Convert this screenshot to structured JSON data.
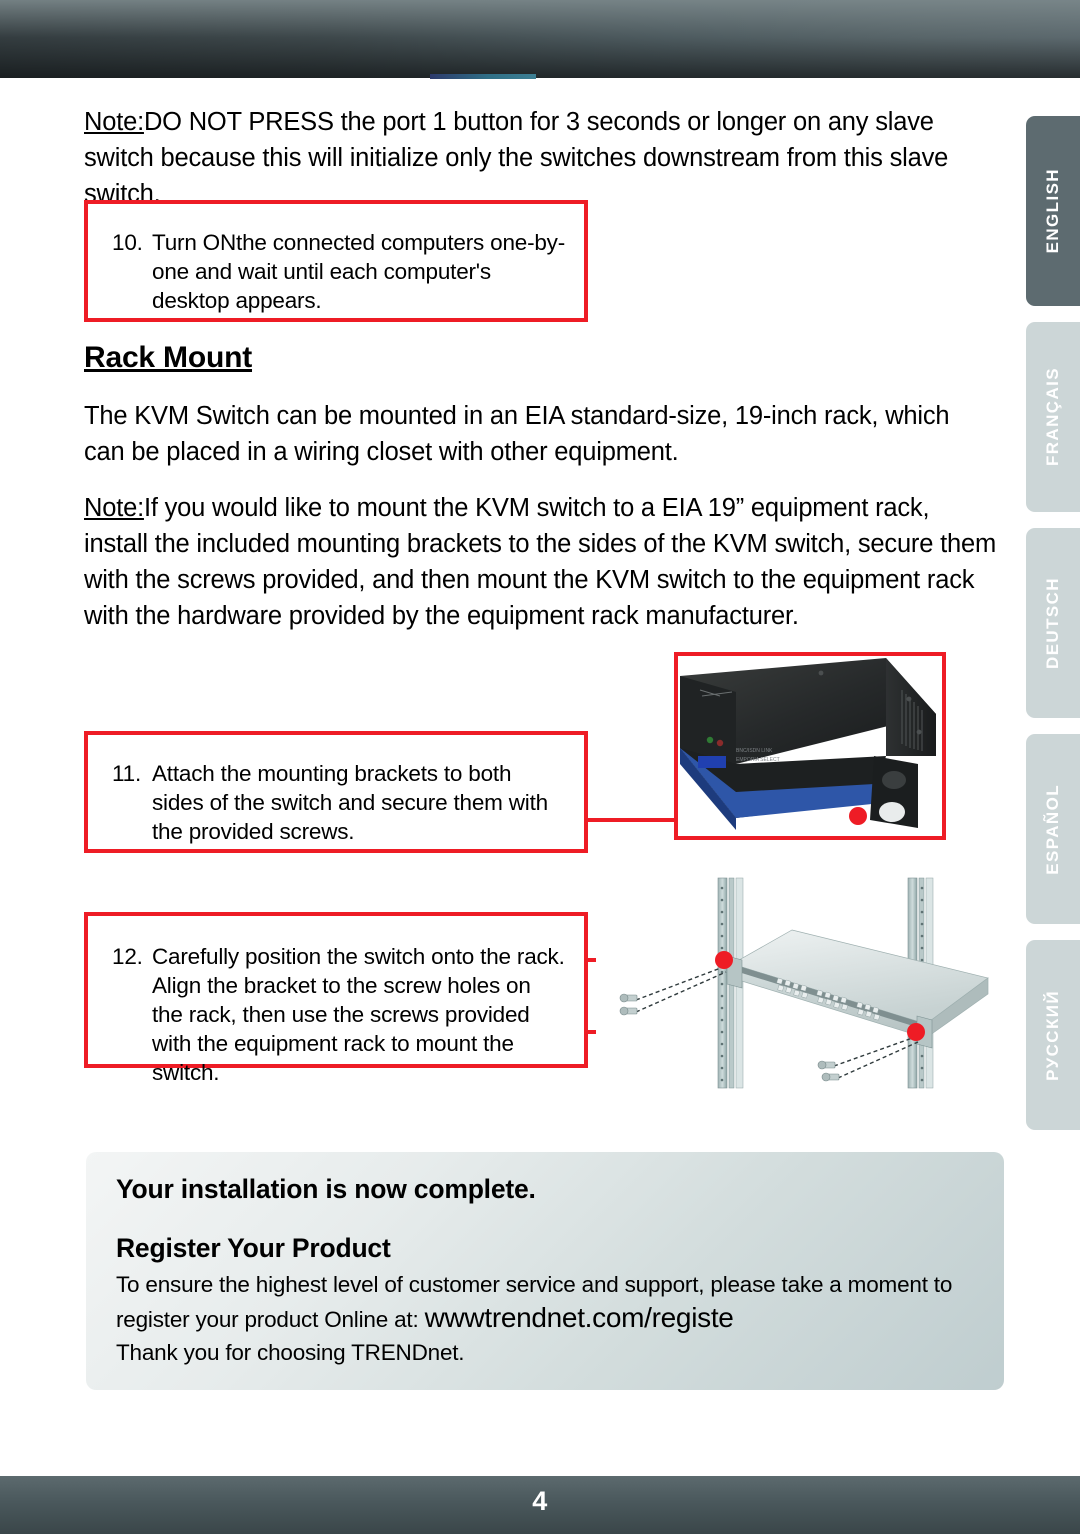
{
  "page": {
    "number": "4",
    "header_accent_color": "#2f6f86",
    "callout_border_color": "#ee1c25"
  },
  "notes": {
    "top": {
      "label": "Note:",
      "text": "DO NOT PRESS the port 1 button for 3 seconds or longer on any slave switch because this will initialize only the switches downstream from this slave switch."
    },
    "rack": {
      "label": "Note:",
      "text": "If you would like to mount the KVM switch to a EIA 19” equipment rack, install the included mounting brackets to the sides of the KVM switch, secure them with the screws provided, and then mount the KVM switch to the equipment rack with the hardware provided by the equipment rack manufacturer."
    }
  },
  "section": {
    "title": "Rack Mount",
    "intro": "The KVM Switch can be mounted in an EIA standard-size, 19-inch rack, which can be placed in a wiring closet with other equipment."
  },
  "steps": [
    {
      "number": "10.",
      "text": "Turn ONthe connected computers one-by-one and wait until each computer's desktop appears."
    },
    {
      "number": "11.",
      "text": "Attach the mounting brackets to both sides of the switch and secure them with the provided screws."
    },
    {
      "number": "12.",
      "text": "Carefully position the switch onto the rack. Align the bracket to the screw holes on the rack, then use the screws provided with the equipment rack to mount the switch."
    }
  ],
  "registration": {
    "complete_title": "Your installation is now complete.",
    "register_title": "Register Your Product",
    "body_line1": "To ensure the highest level of customer service and support, please take a moment to",
    "body_line2_prefix": "register your product Online at:",
    "url": "wwwtrendnet.com/registe",
    "thanks": "Thank you for choosing TRENDnet."
  },
  "language_tabs": [
    {
      "label": "ENGLISH",
      "active": true
    },
    {
      "label": "FRANÇAIS",
      "active": false
    },
    {
      "label": "DEUTSCH",
      "active": false
    },
    {
      "label": "ESPAÑOL",
      "active": false
    },
    {
      "label": "РУССКИЙ",
      "active": false
    }
  ],
  "figures": {
    "switch_photo": "kvm-switch-with-bracket-photo",
    "rack_diagram": "switch-mounted-into-rack-diagram"
  }
}
